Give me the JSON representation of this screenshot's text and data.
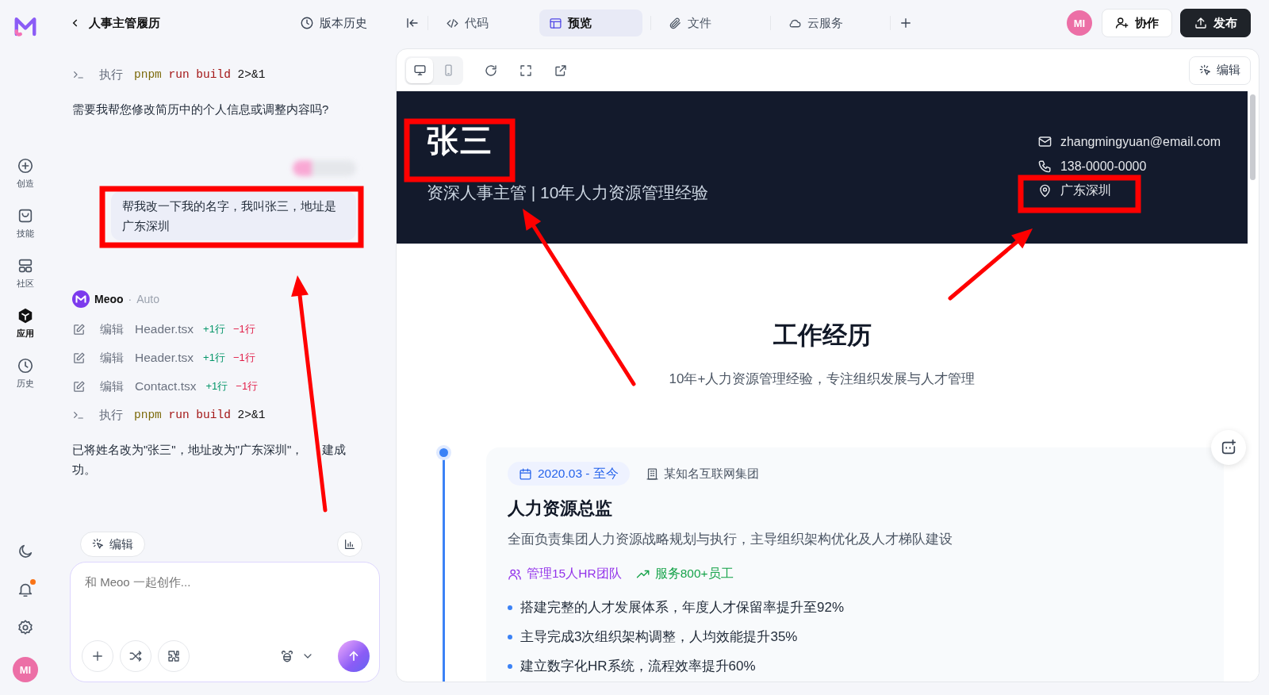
{
  "rail": {
    "items": [
      {
        "label": "创造",
        "kind": "create",
        "selected": false
      },
      {
        "label": "技能",
        "kind": "skills",
        "selected": false
      },
      {
        "label": "社区",
        "kind": "community",
        "selected": false
      },
      {
        "label": "应用",
        "kind": "apps",
        "selected": true
      },
      {
        "label": "历史",
        "kind": "history",
        "selected": false
      }
    ],
    "notifications_unread": true,
    "user_initials": "MI"
  },
  "top_bar": {
    "project_title": "人事主管履历",
    "history_button": "版本历史",
    "tabs": [
      {
        "label": "代码",
        "kind": "code",
        "selected": false
      },
      {
        "label": "预览",
        "kind": "preview",
        "selected": true
      },
      {
        "label": "文件",
        "kind": "files",
        "selected": false
      },
      {
        "label": "云服务",
        "kind": "cloud",
        "selected": false
      }
    ],
    "user_initials": "MI",
    "collab_button": "协作",
    "publish_button": "发布"
  },
  "chat": {
    "messages": [
      {
        "kind": "exec",
        "label": "执行",
        "command": [
          "pnpm",
          "run build",
          "2>&1"
        ]
      },
      {
        "kind": "text",
        "text": "需要我帮您修改简历中的个人信息或调整内容吗?"
      },
      {
        "kind": "user",
        "text": "帮我改一下我的名字，我叫张三，地址是广东深圳"
      },
      {
        "kind": "agent",
        "name": "Meoo",
        "separator": "·",
        "mode": "Auto"
      },
      {
        "kind": "edit",
        "label": "编辑",
        "file": "Header.tsx",
        "added": "+1行",
        "removed": "−1行"
      },
      {
        "kind": "edit",
        "label": "编辑",
        "file": "Header.tsx",
        "added": "+1行",
        "removed": "−1行"
      },
      {
        "kind": "edit",
        "label": "编辑",
        "file": "Contact.tsx",
        "added": "+1行",
        "removed": "−1行"
      },
      {
        "kind": "exec",
        "label": "执行",
        "command": [
          "pnpm",
          "run build",
          "2>&1"
        ]
      },
      {
        "kind": "text",
        "text": "已将姓名改为\"张三\"，地址改为\"广东深圳\"，",
        "text_after_cover": "建成功。"
      }
    ],
    "composer": {
      "edit_chip": "编辑",
      "placeholder": "和 Meoo 一起创作..."
    }
  },
  "preview": {
    "devices": [
      {
        "kind": "desktop",
        "selected": true
      },
      {
        "kind": "mobile",
        "selected": false
      }
    ],
    "edit_button": "编辑",
    "resume": {
      "name": "张三",
      "headline": "资深人事主管 | 10年人力资源管理经验",
      "contacts": [
        {
          "kind": "email",
          "text": "zhangmingyuan@email.com"
        },
        {
          "kind": "phone",
          "text": "138-0000-0000"
        },
        {
          "kind": "location",
          "text": "广东深圳"
        }
      ],
      "section_title": "工作经历",
      "section_subtitle": "10年+人力资源管理经验，专注组织发展与人才管理",
      "experience": {
        "period": "2020.03 - 至今",
        "company": "某知名互联网集团",
        "role": "人力资源总监",
        "summary": "全面负责集团人力资源战略规划与执行，主导组织架构优化及人才梯队建设",
        "tags": [
          {
            "kind": "team",
            "text": "管理15人HR团队",
            "color": "#9333ea"
          },
          {
            "kind": "growth",
            "text": "服务800+员工",
            "color": "#16a34a"
          }
        ],
        "bullets": [
          "搭建完整的人才发展体系，年度人才保留率提升至92%",
          "主导完成3次组织架构调整，人均效能提升35%",
          "建立数字化HR系统，流程效率提升60%"
        ]
      }
    }
  }
}
